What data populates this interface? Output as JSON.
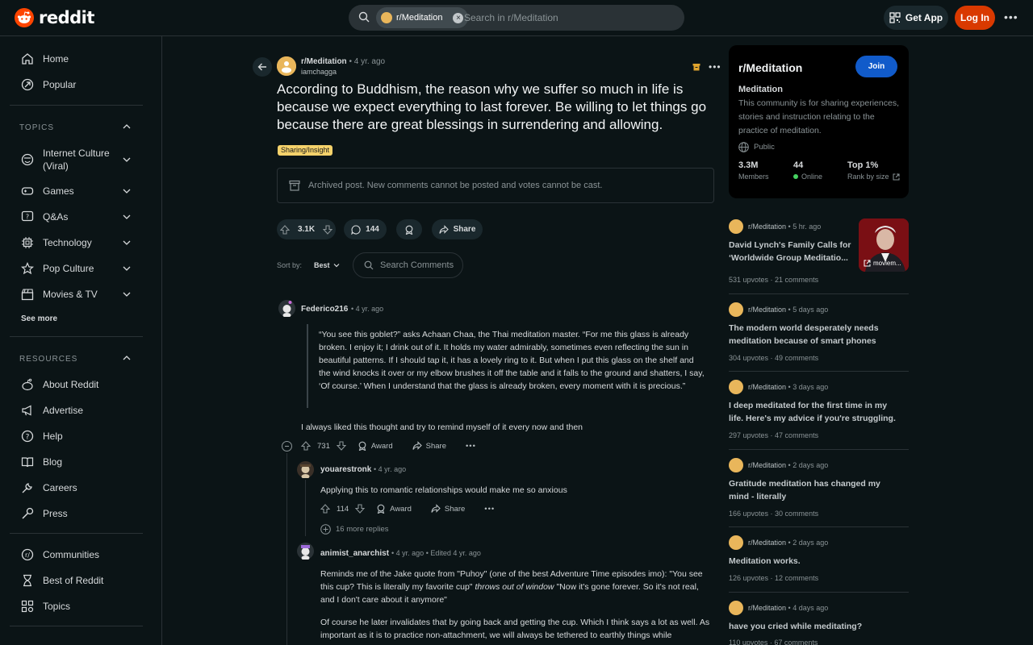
{
  "header": {
    "logo_text": "reddit",
    "search_chip": "r/Meditation",
    "search_placeholder": "Search in r/Meditation",
    "get_app": "Get App",
    "login": "Log In"
  },
  "sidebar": {
    "home": "Home",
    "popular": "Popular",
    "topics_label": "TOPICS",
    "topics": [
      {
        "label_line1": "Internet Culture",
        "label_line2": "(Viral)"
      },
      {
        "label": "Games"
      },
      {
        "label": "Q&As"
      },
      {
        "label": "Technology"
      },
      {
        "label": "Pop Culture"
      },
      {
        "label": "Movies & TV"
      }
    ],
    "see_more": "See more",
    "resources_label": "RESOURCES",
    "resources": [
      "About Reddit",
      "Advertise",
      "Help",
      "Blog",
      "Careers",
      "Press"
    ],
    "extras": [
      "Communities",
      "Best of Reddit",
      "Topics"
    ]
  },
  "post": {
    "subreddit": "r/Meditation",
    "time": "4 yr. ago",
    "author": "iamchagga",
    "title": "According to Buddhism, the reason why we suffer so much in life is because we expect everything to last forever. Be willing to let things go because there are great blessings in surrendering and allowing.",
    "flair": "Sharing/Insight",
    "archived_notice": "Archived post. New comments cannot be posted and votes cannot be cast.",
    "votes": "3.1K",
    "comments": "144",
    "share": "Share",
    "sort_label": "Sort by:",
    "sort_value": "Best",
    "search_comments": "Search Comments"
  },
  "comments": [
    {
      "user": "Federico216",
      "time": "4 yr. ago",
      "quote": "“You see this goblet?” asks Achaan Chaa, the Thai meditation master. “For me this glass is already broken. I enjoy it; I drink out of it. It holds my water admirably, sometimes even reflecting the sun in beautiful patterns. If I should tap it, it has a lovely ring to it. But when I put this glass on the shelf and the wind knocks it over or my elbow brushes it off the table and it falls to the ground and shatters, I say, ‘Of course.’ When I understand that the glass is already broken, every moment with it is precious.”",
      "text": "I always liked this thought and try to remind myself of it every now and then",
      "votes": "731",
      "award": "Award",
      "share": "Share"
    },
    {
      "user": "youarestronk",
      "time": "4 yr. ago",
      "text": "Applying this to romantic relationships would make me so anxious",
      "votes": "114",
      "award": "Award",
      "share": "Share",
      "more_replies": "16 more replies"
    },
    {
      "user": "animist_anarchist",
      "time": "4 yr. ago",
      "edited": "Edited 4 yr. ago",
      "text_a": "Reminds me of the Jake quote from \"Puhoy\" (one of the best Adventure Time episodes imo): \"You see this cup? This is literally my favorite cup\"",
      "text_italic": "throws out of window",
      "text_b": "\"Now it's gone forever. So it's not real, and I don't care about it anymore\"",
      "text2": "Of course he later invalidates that by going back and getting the cup. Which I think says a lot as well. As important as it is to practice non-attachment, we will always be tethered to earthly things while"
    }
  ],
  "community": {
    "title": "r/Meditation",
    "join": "Join",
    "name": "Meditation",
    "description": "This community is for sharing experiences, stories and instruction relating to the practice of meditation.",
    "visibility": "Public",
    "members_value": "3.3M",
    "members_label": "Members",
    "online_value": "44",
    "online_label": "Online",
    "rank_value": "Top 1%",
    "rank_label": "Rank by size"
  },
  "related_posts": [
    {
      "sub": "r/Meditation",
      "time": "5 hr. ago",
      "title": "David Lynch's Family Calls for ‘Worldwide Group Meditatio...",
      "upvotes": "531 upvotes",
      "comments": "21 comments",
      "thumb_label": "moviem..."
    },
    {
      "sub": "r/Meditation",
      "time": "5 days ago",
      "title": "The modern world desperately needs meditation because of smart phones",
      "upvotes": "304 upvotes",
      "comments": "49 comments"
    },
    {
      "sub": "r/Meditation",
      "time": "3 days ago",
      "title": "I deep meditated for the first time in my life. Here's my advice if you're struggling.",
      "upvotes": "297 upvotes",
      "comments": "47 comments"
    },
    {
      "sub": "r/Meditation",
      "time": "2 days ago",
      "title": "Gratitude meditation has changed my mind - literally",
      "upvotes": "166 upvotes",
      "comments": "30 comments"
    },
    {
      "sub": "r/Meditation",
      "time": "2 days ago",
      "title": "Meditation works.",
      "upvotes": "126 upvotes",
      "comments": "12 comments"
    },
    {
      "sub": "r/Meditation",
      "time": "4 days ago",
      "title": "have you cried while meditating?",
      "upvotes": "110 upvotes",
      "comments": "67 comments"
    }
  ],
  "colors": {
    "background": "#0b1416",
    "reddit_orange": "#ff4500",
    "login_button": "#d93900",
    "join_button": "#115bca",
    "flair": "#f5d26b",
    "online": "#46d160"
  }
}
